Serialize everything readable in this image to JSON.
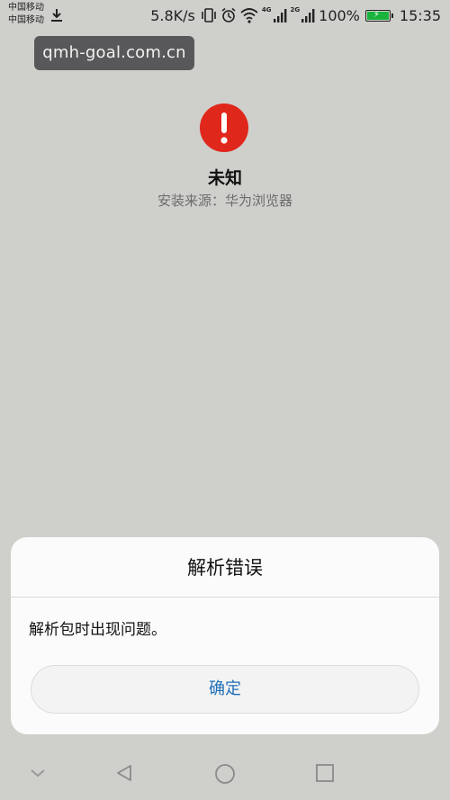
{
  "status_bar": {
    "carrier1": "中国移动",
    "carrier2": "中国移动",
    "speed": "5.8K/s",
    "net1": "4G",
    "net2": "2G",
    "battery": "100%",
    "battery_level": 1.0,
    "time": "15:35"
  },
  "url_bar": {
    "url": "qmh-goal.com.cn"
  },
  "app": {
    "name": "未知",
    "source": "安装来源：华为浏览器",
    "icon": "alert-icon",
    "icon_color": "#e0271c"
  },
  "dialog": {
    "title": "解析错误",
    "message": "解析包时出现问题。",
    "confirm": "确定",
    "accent_color": "#1f6fb8"
  },
  "nav_bar": {
    "icons": [
      "chevron-down-icon",
      "back-icon",
      "home-icon",
      "recents-icon"
    ]
  }
}
